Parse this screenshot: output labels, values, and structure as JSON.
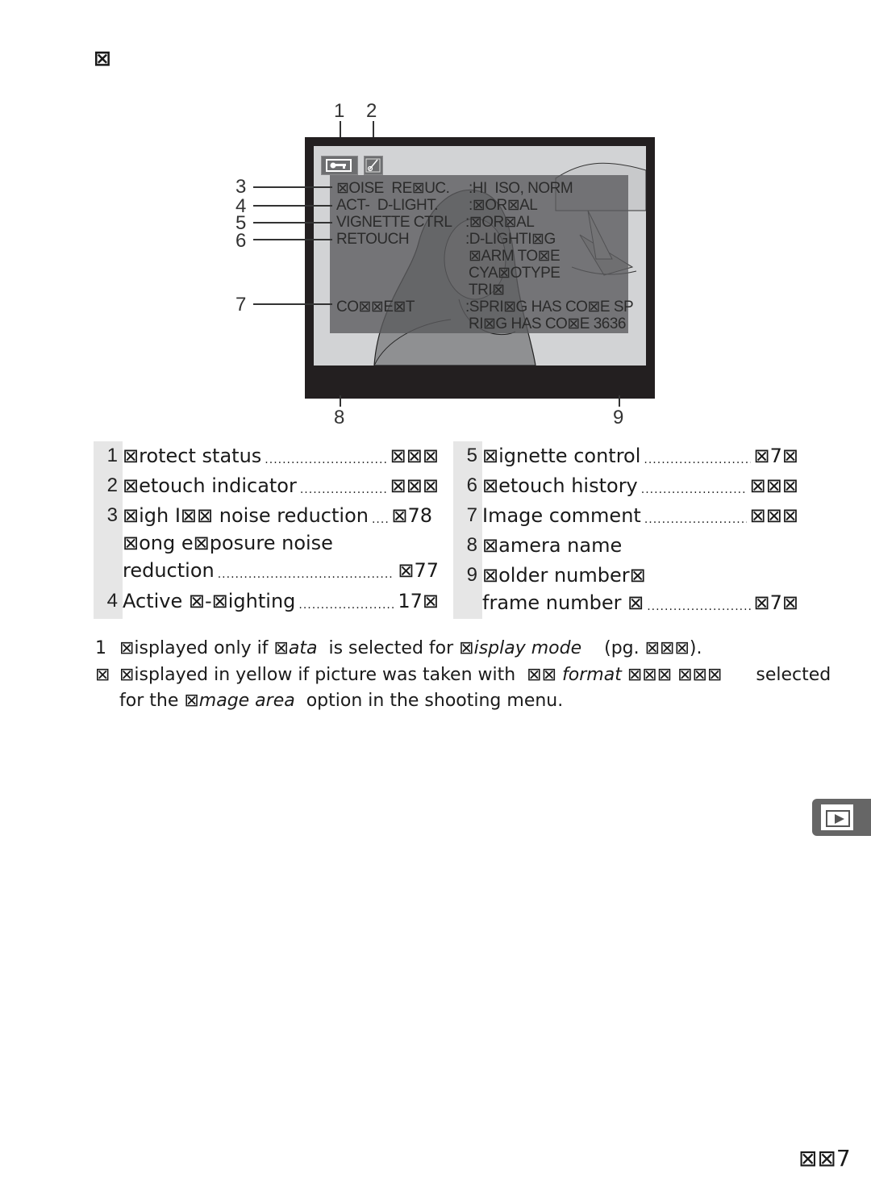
{
  "heading": "⊠",
  "figure": {
    "callouts_top": [
      "1",
      "2"
    ],
    "callouts_left": [
      "3",
      "4",
      "5",
      "6",
      "7"
    ],
    "callouts_bottom": [
      "8",
      "9"
    ],
    "icons": {
      "protect": "key-icon",
      "retouch": "retouch-brush-icon"
    },
    "osd_lines": [
      {
        "label": "⊠OISE  RE⊠UC.",
        "value": ":HI  ISO, NORM"
      },
      {
        "label": "ACT-  D-LIGHT.",
        "value": ":⊠OR⊠AL"
      },
      {
        "label": "VIGNETTE CTRL",
        "value": ":⊠OR⊠AL"
      },
      {
        "label": "RETOUCH",
        "value": ":D-LIGHTI⊠G"
      },
      {
        "label": "",
        "value": "⊠ARM TO⊠E"
      },
      {
        "label": "",
        "value": "CYA⊠OTYPE"
      },
      {
        "label": "",
        "value": "TRI⊠"
      },
      {
        "label": "CO⊠⊠E⊠T",
        "value": ":SPRI⊠G HAS CO⊠E SP"
      },
      {
        "label": "",
        "value": "RI⊠G HAS CO⊠E 3636"
      }
    ]
  },
  "legend": {
    "left": [
      {
        "num": "1",
        "label": "⊠rotect status",
        "page": "⊠⊠⊠"
      },
      {
        "num": "2",
        "label": "⊠etouch indicator",
        "page": "⊠⊠⊠"
      },
      {
        "num": "3",
        "label": "⊠igh I⊠⊠ noise reduction",
        "page": "⊠78"
      },
      {
        "num": "",
        "label": "⊠ong e⊠posure noise",
        "page": ""
      },
      {
        "num": "",
        "label": "reduction",
        "page": "⊠77"
      },
      {
        "num": "4",
        "label": "Active ⊠-⊠ighting",
        "page": "17⊠"
      }
    ],
    "right": [
      {
        "num": "5",
        "label": "⊠ignette control",
        "page": "⊠7⊠"
      },
      {
        "num": "6",
        "label": "⊠etouch history",
        "page": "⊠⊠⊠"
      },
      {
        "num": "7",
        "label": "Image comment",
        "page": "⊠⊠⊠"
      },
      {
        "num": "8",
        "label": "⊠amera name",
        "page": ""
      },
      {
        "num": "9",
        "label": "⊠older number⊠",
        "page": ""
      },
      {
        "num": "",
        "label": "frame number ⊠",
        "page": "⊠7⊠"
      }
    ]
  },
  "notes": [
    {
      "mark": "1",
      "parts": [
        {
          "t": "⊠isplayed only if ",
          "i": false
        },
        {
          "t": "⊠ata",
          "i": true
        },
        {
          "t": "  is selected for ",
          "i": false
        },
        {
          "t": "⊠isplay mode",
          "i": true
        },
        {
          "t": "    (pg. ⊠⊠⊠).",
          "i": false
        }
      ]
    },
    {
      "mark": "⊠",
      "parts": [
        {
          "t": "⊠isplayed in yellow if picture was taken with  ",
          "i": false
        },
        {
          "t": "⊠⊠ format ",
          "i": true
        },
        {
          "t": "⊠⊠⊠ ⊠⊠⊠",
          "i": false
        },
        {
          "t": "      selected",
          "i": false
        }
      ]
    },
    {
      "mark": "",
      "parts": [
        {
          "t": "for the ",
          "i": false
        },
        {
          "t": "⊠mage area",
          "i": true
        },
        {
          "t": "  option in the shooting menu.",
          "i": false
        }
      ]
    }
  ],
  "side_tab": {
    "icon": "playback-icon"
  },
  "page_number": "⊠⊠7"
}
